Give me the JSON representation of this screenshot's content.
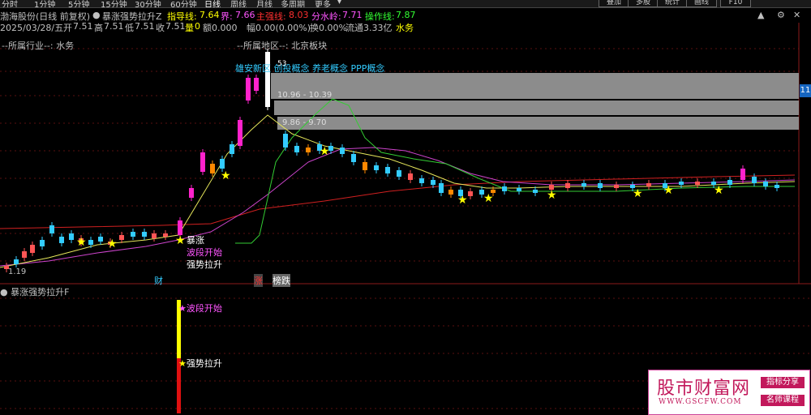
{
  "tabs": [
    "分时",
    "1分钟",
    "5分钟",
    "15分钟",
    "30分钟",
    "60分钟",
    "日线",
    "周线",
    "月线",
    "多周期",
    "更多"
  ],
  "active_tab": "日线",
  "right_buttons": [
    "叠加",
    "多股",
    "统计",
    "画线",
    "F10"
  ],
  "title": "渤海股份(日线 前复权)",
  "indicator_name": "暴涨强势拉升Z",
  "indicators": [
    {
      "label": "指导线: ",
      "value": "7.64",
      "color": "#ffff00"
    },
    {
      "label": "界: ",
      "value": "7.66",
      "color": "#ff55ff"
    },
    {
      "label": "主强线: ",
      "value": "8.03",
      "color": "#ff3030"
    },
    {
      "label": "分水岭: ",
      "value": "7.71",
      "color": "#ff55ff"
    },
    {
      "label": "操作线: ",
      "value": "7.87",
      "color": "#33ff33"
    }
  ],
  "quote": {
    "date": "2025/03/28/五",
    "open_label": "开",
    "open": "7.51",
    "high_label": "高",
    "high": "7.51",
    "low_label": "低",
    "low": "7.51",
    "close_label": "收",
    "close": "7.51",
    "vol_label": "量",
    "vol": "0",
    "amount": "额0.000",
    "amp": "幅0.00(0.00%)",
    "turnover": "换0.00%",
    "float": "流通3.33亿",
    "sector": "水务"
  },
  "industry_label": "--所属行业--: 水务",
  "region_label": "--所属地区--: 北京板块",
  "concepts": "雄安新区 创投概念 养老概念 PPP概念",
  "zones": [
    "10.96 - 10.39",
    "9.86 - 9.70"
  ],
  "axis_right_value": "11",
  "price_labels": {
    "low": "1.19",
    "peak": "53"
  },
  "main_annotations": [
    "暴涨",
    "波段开始",
    "强势拉升"
  ],
  "event_markers": {
    "cai": "财",
    "zhang": "涨",
    "bang": "榜跌",
    "li": "里"
  },
  "sub_indicator_name": "暴涨强势拉升F",
  "sub_annotations": [
    "波段开始",
    "强势拉升"
  ],
  "watermark": {
    "main": "股市财富网",
    "url": "WWW.GSCFW.COM",
    "tag1": "指标分享",
    "tag2": "名师课程"
  }
}
